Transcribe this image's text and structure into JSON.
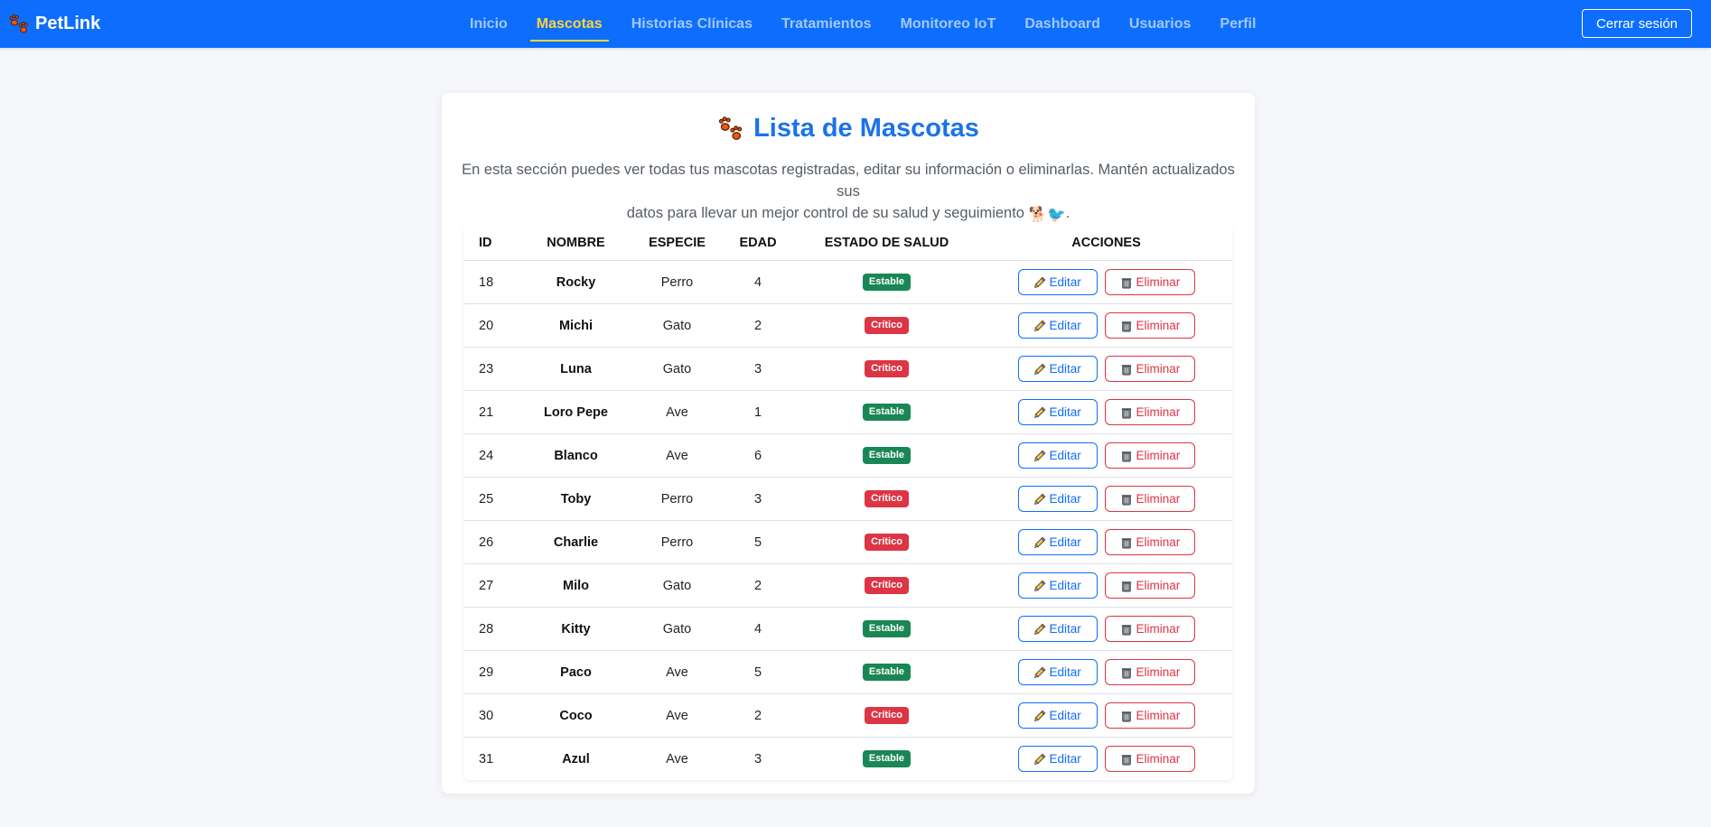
{
  "brand": {
    "name": "PetLink"
  },
  "nav": {
    "items": [
      {
        "label": "Inicio",
        "active": false
      },
      {
        "label": "Mascotas",
        "active": true
      },
      {
        "label": "Historias Clínicas",
        "active": false
      },
      {
        "label": "Tratamientos",
        "active": false
      },
      {
        "label": "Monitoreo IoT",
        "active": false
      },
      {
        "label": "Dashboard",
        "active": false
      },
      {
        "label": "Usuarios",
        "active": false
      },
      {
        "label": "Perfil",
        "active": false
      }
    ],
    "logout_label": "Cerrar sesión"
  },
  "page": {
    "title": "Lista de Mascotas",
    "subtitle_1": "En esta sección puedes ver todas tus mascotas registradas, editar su información o eliminarlas. Mantén actualizados sus",
    "subtitle_2": "datos para llevar un mejor control de su salud y seguimiento",
    "subtitle_emoji": "🐕🐦",
    "subtitle_end": "."
  },
  "table": {
    "headers": {
      "id": "ID",
      "name": "NOMBRE",
      "species": "ESPECIE",
      "age": "EDAD",
      "health": "ESTADO DE SALUD",
      "actions": "ACCIONES"
    },
    "edit_label": "Editar",
    "delete_label": "Eliminar",
    "rows": [
      {
        "id": "18",
        "name": "Rocky",
        "species": "Perro",
        "age": "4",
        "health": "Estable"
      },
      {
        "id": "20",
        "name": "Michi",
        "species": "Gato",
        "age": "2",
        "health": "Crítico"
      },
      {
        "id": "23",
        "name": "Luna",
        "species": "Gato",
        "age": "3",
        "health": "Crítico"
      },
      {
        "id": "21",
        "name": "Loro Pepe",
        "species": "Ave",
        "age": "1",
        "health": "Estable"
      },
      {
        "id": "24",
        "name": "Blanco",
        "species": "Ave",
        "age": "6",
        "health": "Estable"
      },
      {
        "id": "25",
        "name": "Toby",
        "species": "Perro",
        "age": "3",
        "health": "Crítico"
      },
      {
        "id": "26",
        "name": "Charlie",
        "species": "Perro",
        "age": "5",
        "health": "Crítico"
      },
      {
        "id": "27",
        "name": "Milo",
        "species": "Gato",
        "age": "2",
        "health": "Crítico"
      },
      {
        "id": "28",
        "name": "Kitty",
        "species": "Gato",
        "age": "4",
        "health": "Estable"
      },
      {
        "id": "29",
        "name": "Paco",
        "species": "Ave",
        "age": "5",
        "health": "Estable"
      },
      {
        "id": "30",
        "name": "Coco",
        "species": "Ave",
        "age": "2",
        "health": "Crítico"
      },
      {
        "id": "31",
        "name": "Azul",
        "species": "Ave",
        "age": "3",
        "health": "Estable"
      }
    ]
  },
  "colors": {
    "primary": "#0d6efd",
    "active_nav": "#ffd43b",
    "stable": "#198754",
    "critical": "#dc3545",
    "title": "#1a73e8"
  }
}
